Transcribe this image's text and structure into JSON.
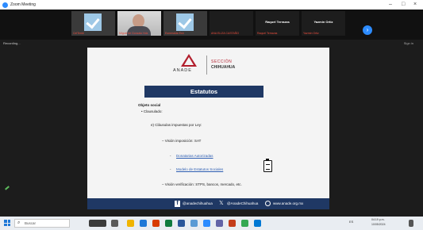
{
  "window": {
    "title": "Zoom Meeting",
    "controls": [
      "–",
      "□",
      "×"
    ]
  },
  "participants": [
    {
      "name": "CelTerrie",
      "kind": "check"
    },
    {
      "name": "Miguel de Gonzalo Hdz",
      "kind": "video"
    },
    {
      "name": "Esmeralda Esh",
      "kind": "check"
    },
    {
      "name": "ANA ELIZA CASTAÑO",
      "kind": "plain",
      "big": ""
    },
    {
      "name": "Raquel Terrazas",
      "kind": "plain",
      "big": "Raquel Terrazas"
    },
    {
      "name": "Yazmin Ortiz",
      "kind": "plain",
      "big": "Yazmin Ortiz"
    }
  ],
  "recording_label": "Recording...",
  "signin_label": "Sign in",
  "slide": {
    "org": "ANADE",
    "section_line1": "SECCIÓN",
    "section_line2": "CHIHUAHUA",
    "band_title": "Estatutos",
    "bullet1": "Objeto social",
    "bullet2": "• Clausulado:",
    "item_e": "e)  Cláusulas impuestas por Ley:",
    "vision_sat": "–  Visión imposición: SAT",
    "link1": "Donatarias Autorizadas",
    "link2": "Modelo de Estatutos Sociales",
    "vision_verif": "–  Visión verificación: STPS, bancos, mercado, etc.",
    "footer_fb": "@anadechihuahua",
    "footer_x": "@AnadeChihuahua",
    "footer_web": "www.anade.org.mx"
  },
  "taskbar": {
    "search_placeholder": "Buscar",
    "tray_text": "ES",
    "clock_time": "04:19 p.m.",
    "clock_date": "10/05/2024"
  },
  "colors": {
    "brand_red": "#b21f2d",
    "navy": "#1f3864",
    "zoom_blue": "#2d8cff"
  }
}
